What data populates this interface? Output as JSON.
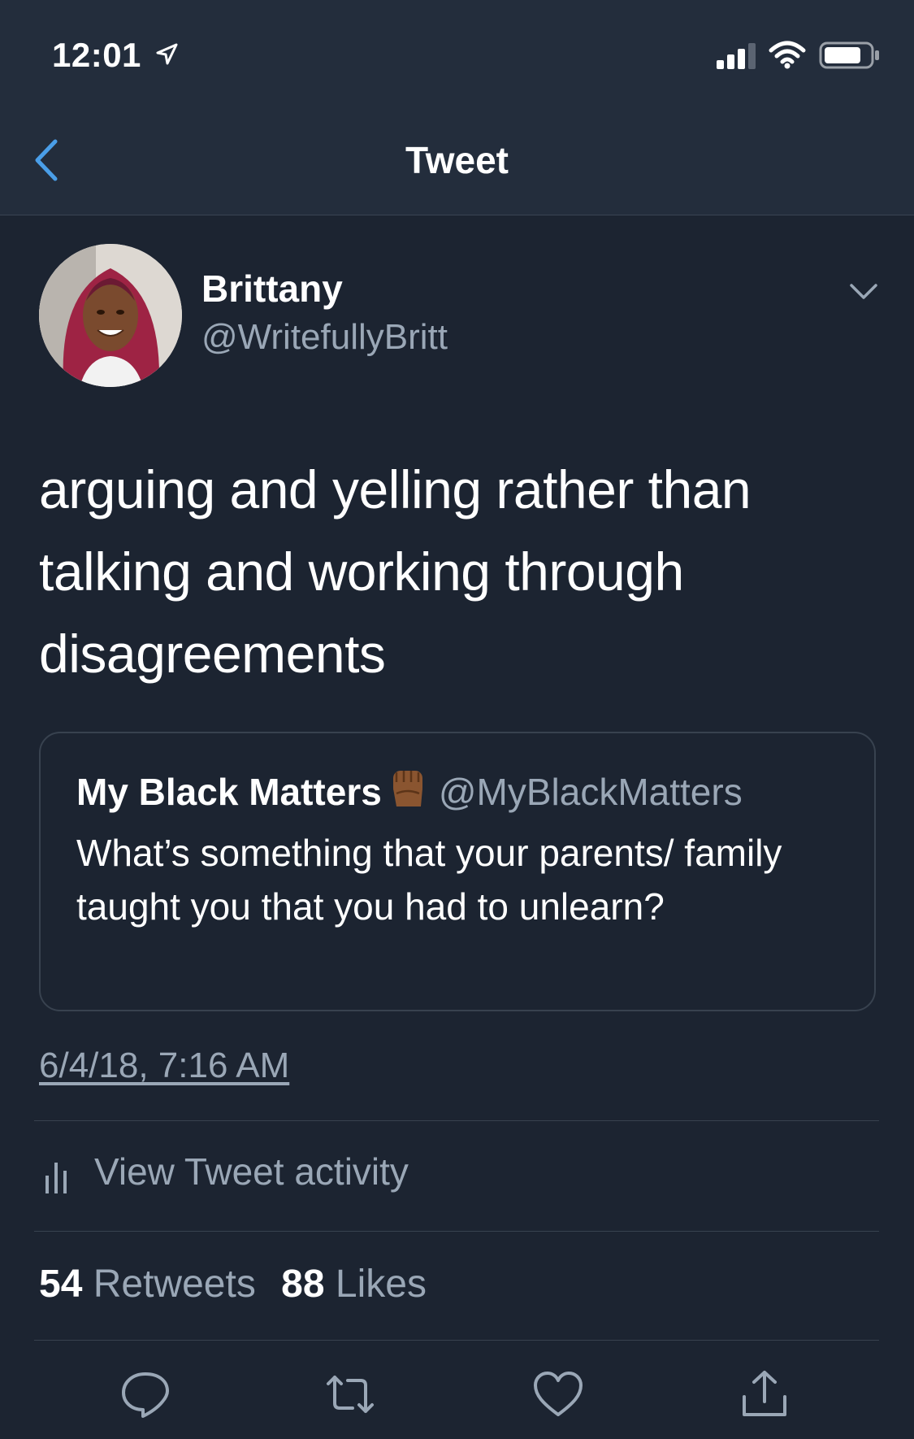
{
  "status_bar": {
    "time": "12:01",
    "icons": [
      "location-arrow-icon",
      "cellular-signal-icon",
      "wifi-icon",
      "battery-icon"
    ]
  },
  "nav": {
    "title": "Tweet",
    "back_icon": "chevron-left-icon"
  },
  "author": {
    "name": "Brittany",
    "handle": "@WritefullyBritt",
    "menu_icon": "chevron-down-icon"
  },
  "tweet": {
    "text": "arguing and yelling rather than talking and working through disagreements"
  },
  "quoted_tweet": {
    "name": "My Black Matters",
    "emoji": "raised-fist-icon",
    "handle": "@MyBlackMatters",
    "text": "What’s something that your parents/ family taught you that you had to unlearn?"
  },
  "timestamp": "6/4/18, 7:16 AM",
  "activity": {
    "label": "View Tweet activity",
    "icon": "bar-chart-icon"
  },
  "stats": {
    "retweets_count": "54",
    "retweets_label": "Retweets",
    "likes_count": "88",
    "likes_label": "Likes"
  },
  "actions": [
    "reply-icon",
    "retweet-icon",
    "like-icon",
    "share-icon"
  ],
  "colors": {
    "background": "#1c2431",
    "header": "#232d3c",
    "secondary_text": "#9aa7b6",
    "accent": "#4a9ee8",
    "divider": "#38424f"
  }
}
